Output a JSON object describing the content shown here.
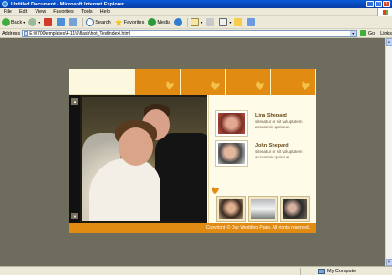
{
  "window": {
    "title": "Untitled Document - Microsoft Internet Explorer",
    "controls": [
      "minimize",
      "maximize",
      "close"
    ]
  },
  "menubar": {
    "items": [
      "File",
      "Edit",
      "View",
      "Favorites",
      "Tools",
      "Help"
    ]
  },
  "toolbar": {
    "back_label": "Back",
    "search_label": "Search",
    "favorites_label": "Favorites",
    "media_label": "Media"
  },
  "address": {
    "label": "Address",
    "url": "E:\\0700templates\\4-11\\6\\flash\\hot_TestIndex\\.html",
    "go_label": "Go",
    "links_label": "Links"
  },
  "site": {
    "nav_tab_count": 4,
    "profiles": [
      {
        "name": "Lina Shepard",
        "desc": "sitenatur or sit voluptatem accrusmis quisque."
      },
      {
        "name": "John Shepard",
        "desc": "sitenatur or sit voluptatem accrusmis quisque."
      }
    ],
    "gallery_icons": [
      "couple-photo",
      "limousine-photo",
      "group-photo"
    ],
    "footer": "Copyright © Our Wedding Page. All rights reserved."
  },
  "status": {
    "zone": "My Computer"
  },
  "colors": {
    "accent": "#e28b12",
    "cream": "#fefbe9",
    "desktop": "#6d6c5d"
  }
}
